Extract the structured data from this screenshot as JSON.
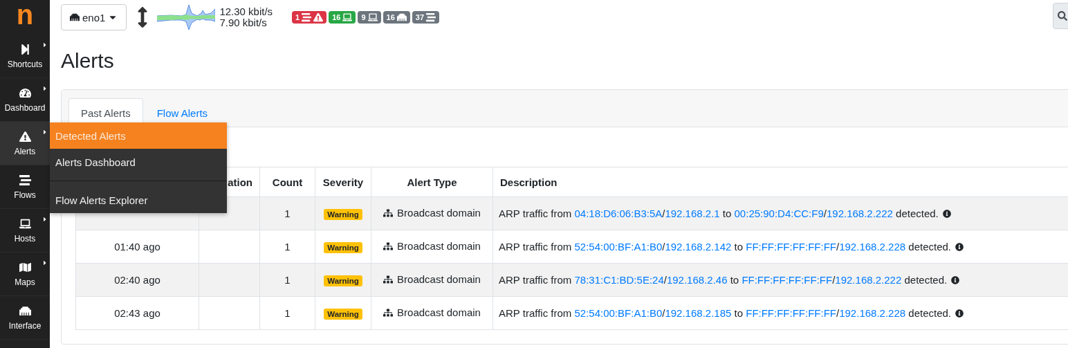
{
  "logo": {
    "letter": "n"
  },
  "sidebar": {
    "items": [
      {
        "label": "Shortcuts",
        "kind": "shortcuts",
        "has_submenu": true,
        "selected": false
      },
      {
        "label": "Dashboard",
        "kind": "dashboard",
        "has_submenu": true,
        "selected": false
      },
      {
        "label": "Alerts",
        "kind": "alerts",
        "has_submenu": true,
        "selected": true
      },
      {
        "label": "Flows",
        "kind": "flows",
        "has_submenu": false,
        "selected": false
      },
      {
        "label": "Hosts",
        "kind": "hosts",
        "has_submenu": true,
        "selected": false
      },
      {
        "label": "Maps",
        "kind": "maps",
        "has_submenu": true,
        "selected": false
      },
      {
        "label": "Interface",
        "kind": "interface",
        "has_submenu": false,
        "selected": false
      }
    ]
  },
  "submenu": {
    "items": [
      {
        "label": "Detected Alerts",
        "selected": true,
        "divider_before": false
      },
      {
        "label": "Alerts Dashboard",
        "selected": false,
        "divider_before": false
      },
      {
        "label": "Flow Alerts Explorer",
        "selected": false,
        "divider_before": true
      }
    ]
  },
  "topbar": {
    "interface": "eno1",
    "upload": "12.30 kbit/s",
    "download": "7.90 kbit/s",
    "badges": [
      {
        "count": "1",
        "kind": "alerts",
        "color": "#dc3545"
      },
      {
        "count": "16",
        "kind": "local_hosts",
        "color": "#28a745"
      },
      {
        "count": "9",
        "kind": "remote_hosts",
        "color": "#6c757d"
      },
      {
        "count": "16",
        "kind": "devices",
        "color": "#6c757d"
      },
      {
        "count": "37",
        "kind": "flows",
        "color": "#6c757d"
      }
    ]
  },
  "page": {
    "title": "Alerts"
  },
  "tabs": [
    {
      "label": "Past Alerts",
      "selected": true
    },
    {
      "label": "Flow Alerts",
      "selected": false
    }
  ],
  "table": {
    "columns": [
      "ation",
      "Count",
      "Severity",
      "Alert Type",
      "Description"
    ],
    "rows": [
      {
        "count": "1",
        "severity": "Warning",
        "alert_type": "Broadcast domain",
        "description": [
          {
            "text": "ARP traffic from ",
            "kind": "text"
          },
          {
            "text": "04:18:D6:06:B3:5A",
            "kind": "link"
          },
          {
            "text": "/",
            "kind": "text"
          },
          {
            "text": "192.168.2.1",
            "kind": "link"
          },
          {
            "text": " to ",
            "kind": "text"
          },
          {
            "text": "00:25:90:D4:CC:F9",
            "kind": "link"
          },
          {
            "text": "/",
            "kind": "text"
          },
          {
            "text": "192.168.2.222",
            "kind": "link"
          },
          {
            "text": " detected.",
            "kind": "text"
          }
        ]
      },
      {
        "date": "01:40 ago",
        "count": "1",
        "severity": "Warning",
        "alert_type": "Broadcast domain",
        "description": [
          {
            "text": "ARP traffic from ",
            "kind": "text"
          },
          {
            "text": "52:54:00:BF:A1:B0",
            "kind": "link"
          },
          {
            "text": "/",
            "kind": "text"
          },
          {
            "text": "192.168.2.142",
            "kind": "link"
          },
          {
            "text": " to ",
            "kind": "text"
          },
          {
            "text": "FF:FF:FF:FF:FF:FF",
            "kind": "link"
          },
          {
            "text": "/",
            "kind": "text"
          },
          {
            "text": "192.168.2.228",
            "kind": "link"
          },
          {
            "text": " detected.",
            "kind": "text"
          }
        ]
      },
      {
        "date": "02:40 ago",
        "count": "1",
        "severity": "Warning",
        "alert_type": "Broadcast domain",
        "description": [
          {
            "text": "ARP traffic from ",
            "kind": "text"
          },
          {
            "text": "78:31:C1:BD:5E:24",
            "kind": "link"
          },
          {
            "text": "/",
            "kind": "text"
          },
          {
            "text": "192.168.2.46",
            "kind": "link"
          },
          {
            "text": " to ",
            "kind": "text"
          },
          {
            "text": "FF:FF:FF:FF:FF:FF",
            "kind": "link"
          },
          {
            "text": "/",
            "kind": "text"
          },
          {
            "text": "192.168.2.222",
            "kind": "link"
          },
          {
            "text": " detected.",
            "kind": "text"
          }
        ]
      },
      {
        "date": "02:43 ago",
        "count": "1",
        "severity": "Warning",
        "alert_type": "Broadcast domain",
        "description": [
          {
            "text": "ARP traffic from ",
            "kind": "text"
          },
          {
            "text": "52:54:00:BF:A1:B0",
            "kind": "link"
          },
          {
            "text": "/",
            "kind": "text"
          },
          {
            "text": "192.168.2.185",
            "kind": "link"
          },
          {
            "text": " to ",
            "kind": "text"
          },
          {
            "text": "FF:FF:FF:FF:FF:FF",
            "kind": "link"
          },
          {
            "text": "/",
            "kind": "text"
          },
          {
            "text": "192.168.2.228",
            "kind": "link"
          },
          {
            "text": " detected.",
            "kind": "text"
          }
        ]
      }
    ]
  }
}
